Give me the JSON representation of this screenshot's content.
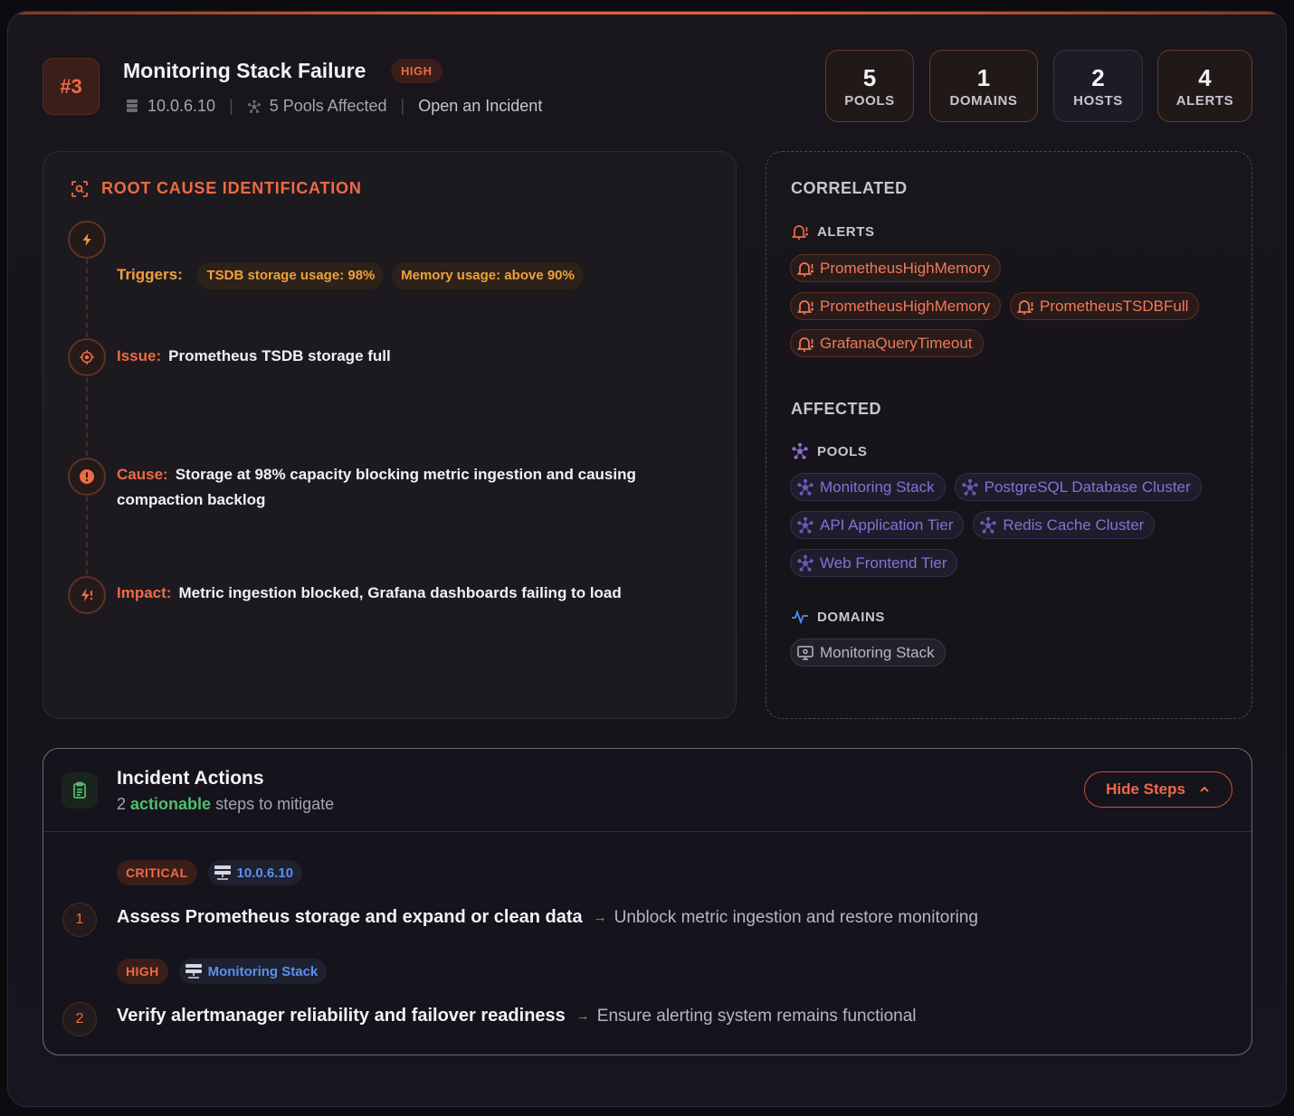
{
  "incident": {
    "rank": "#3",
    "title": "Monitoring Stack Failure",
    "severity": "HIGH",
    "host": "10.0.6.10",
    "pools_affected": "5 Pools Affected",
    "open_incident": "Open an Incident"
  },
  "stats": [
    {
      "value": "5",
      "label": "POOLS"
    },
    {
      "value": "1",
      "label": "DOMAINS"
    },
    {
      "value": "2",
      "label": "HOSTS"
    },
    {
      "value": "4",
      "label": "ALERTS"
    }
  ],
  "root_cause": {
    "heading": "ROOT CAUSE IDENTIFICATION",
    "triggers_label": "Triggers:",
    "triggers": [
      "TSDB storage usage: 98%",
      "Memory usage: above 90%"
    ],
    "issue_label": "Issue:",
    "issue": "Prometheus TSDB storage full",
    "cause_label": "Cause:",
    "cause": "Storage at 98% capacity blocking metric ingestion and causing compaction backlog",
    "impact_label": "Impact:",
    "impact": "Metric ingestion blocked, Grafana dashboards failing to load"
  },
  "correlated": {
    "heading": "CORRELATED",
    "alerts_label": "ALERTS",
    "alerts": [
      "PrometheusHighMemory",
      "PrometheusHighMemory",
      "PrometheusTSDBFull",
      "GrafanaQueryTimeout"
    ],
    "affected_heading": "AFFECTED",
    "pools_label": "POOLS",
    "pools": [
      "Monitoring Stack",
      "PostgreSQL Database Cluster",
      "API Application Tier",
      "Redis Cache Cluster",
      "Web Frontend Tier"
    ],
    "domains_label": "DOMAINS",
    "domains": [
      "Monitoring Stack"
    ]
  },
  "actions": {
    "title": "Incident Actions",
    "subtitle_count": "2",
    "subtitle_highlight": "actionable",
    "subtitle_rest": "steps to mitigate",
    "toggle_label": "Hide Steps",
    "steps": [
      {
        "num": "1",
        "severity": "CRITICAL",
        "target": "10.0.6.10",
        "action": "Assess Prometheus storage and expand or clean data",
        "result": "Unblock metric ingestion and restore monitoring"
      },
      {
        "num": "2",
        "severity": "HIGH",
        "target": "Monitoring Stack",
        "action": "Verify alertmanager reliability and failover readiness",
        "result": "Ensure alerting system remains functional"
      }
    ]
  },
  "colors": {
    "accent": "#ef6a43",
    "amber": "#f0a03c",
    "pool": "#8a6fd6",
    "link_blue": "#5b8ff0",
    "success": "#4fbf6b"
  },
  "icons": {
    "host": "server-icon",
    "pools": "cluster-icon",
    "trigger": "bolt-icon",
    "issue": "crosshair-icon",
    "cause": "alert-circle-icon",
    "impact": "impact-bolt-icon",
    "alert": "bell-alert-icon",
    "domain": "pulse-icon",
    "actions": "clipboard-icon"
  }
}
